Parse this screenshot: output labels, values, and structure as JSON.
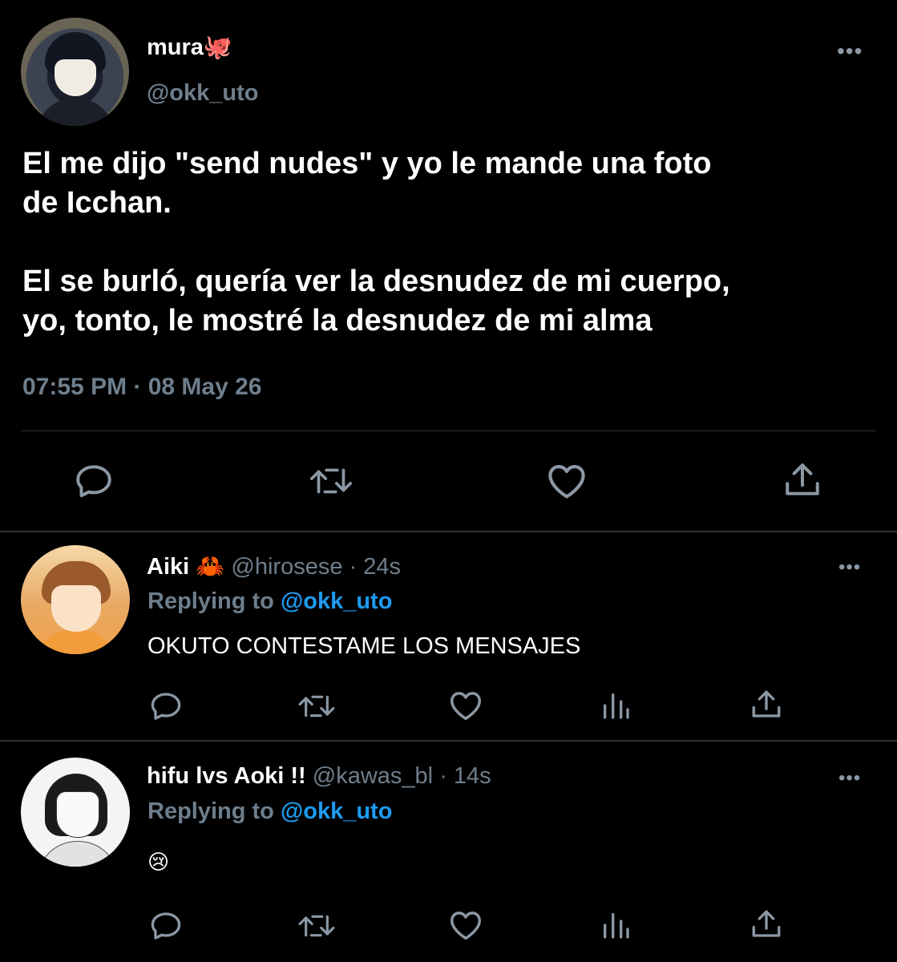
{
  "main_tweet": {
    "display_name": "mura",
    "name_emoji": "🐙",
    "handle": "@okk_uto",
    "text": "El me dijo \"send nudes\" y yo le mande una foto\nde Icchan.\n\nEl se burló, quería ver la desnudez de mi cuerpo,\nyo, tonto, le mostré la desnudez de mi alma",
    "timestamp": "07:55 PM · 08 May 26",
    "more": "•••",
    "actions": [
      "reply-icon",
      "retweet-icon",
      "like-icon",
      "share-icon"
    ]
  },
  "replies": [
    {
      "display_name": "Aiki",
      "name_emoji": "🦀",
      "handle": "@hirosese",
      "time": "· 24s",
      "replying_prefix": "Replying to",
      "replying_handle": "@okk_uto",
      "text": "OKUTO CONTESTAME LOS MENSAJES",
      "more": "•••",
      "actions": [
        "reply-icon",
        "retweet-icon",
        "like-icon",
        "analytics-icon",
        "share-icon"
      ]
    },
    {
      "display_name": "hifu lvs Aoki !!",
      "name_emoji": "",
      "handle": "@kawas_bl",
      "time": "· 14s",
      "replying_prefix": "Replying to",
      "replying_handle": "@okk_uto",
      "text": "😢",
      "more": "•••",
      "actions": [
        "reply-icon",
        "retweet-icon",
        "like-icon",
        "analytics-icon",
        "share-icon"
      ]
    }
  ],
  "colors": {
    "background": "#000000",
    "text": "#ffffff",
    "muted": "#6e7e8c",
    "link": "#1d9bf0",
    "divider": "#2f3336"
  }
}
